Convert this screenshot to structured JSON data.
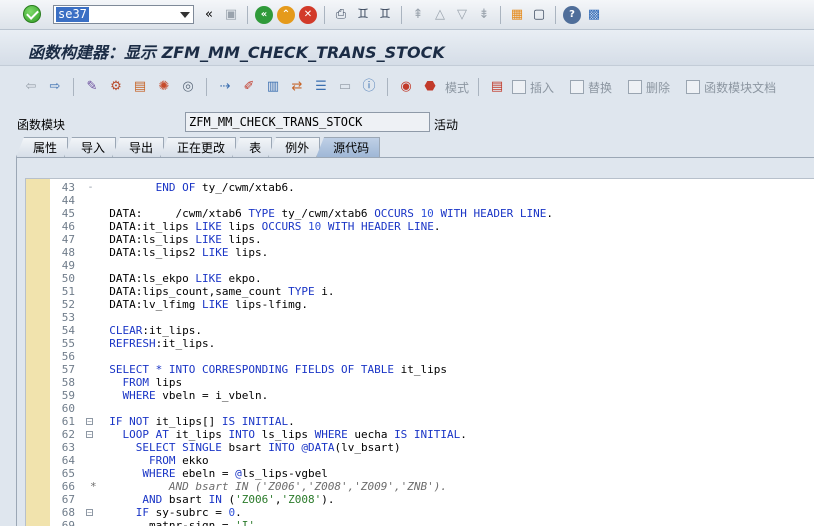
{
  "command": {
    "value": "se37"
  },
  "title": "函数构建器：显示 ZFM_MM_CHECK_TRANS_STOCK",
  "app_toolbar": {
    "buttons": [
      {
        "label": "模式"
      },
      {
        "label": "插入"
      },
      {
        "label": "替换"
      },
      {
        "label": "删除"
      },
      {
        "label": "函数模块文档"
      }
    ]
  },
  "function_module": {
    "label": "函数模块",
    "value": "ZFM_MM_CHECK_TRANS_STOCK",
    "status": "活动"
  },
  "tabs": [
    {
      "label": "属性",
      "active": false
    },
    {
      "label": "导入",
      "active": false
    },
    {
      "label": "导出",
      "active": false
    },
    {
      "label": "正在更改",
      "active": false
    },
    {
      "label": "表",
      "active": false
    },
    {
      "label": "例外",
      "active": false
    },
    {
      "label": "源代码",
      "active": true
    }
  ],
  "colors": {
    "keyword": "#1a35c6",
    "number": "#2d4fd8",
    "gutter": "#f1e3ad",
    "title": "#1b2c45"
  },
  "code": [
    {
      "n": "43",
      "fold": "dash",
      "t": [
        [
          "         ",
          ""
        ],
        [
          "END OF",
          "kw"
        ],
        [
          " ty_/cwm/xtab6.",
          ""
        ]
      ]
    },
    {
      "n": "44",
      "t": []
    },
    {
      "n": "45",
      "t": [
        [
          "  ",
          ""
        ],
        [
          "DATA",
          ""
        ],
        [
          ":     /cwm/xtab6 ",
          ""
        ],
        [
          "TYPE",
          "kw"
        ],
        [
          " ty_/cwm/xtab6 ",
          ""
        ],
        [
          "OCCURS",
          "kw"
        ],
        [
          " ",
          ""
        ],
        [
          "10",
          "num"
        ],
        [
          " ",
          ""
        ],
        [
          "WITH HEADER LINE",
          "kw"
        ],
        [
          ".",
          ""
        ]
      ]
    },
    {
      "n": "46",
      "t": [
        [
          "  ",
          ""
        ],
        [
          "DATA",
          ""
        ],
        [
          ":it_lips ",
          ""
        ],
        [
          "LIKE",
          "kw"
        ],
        [
          " lips ",
          ""
        ],
        [
          "OCCURS",
          "kw"
        ],
        [
          " ",
          ""
        ],
        [
          "10",
          "num"
        ],
        [
          " ",
          ""
        ],
        [
          "WITH HEADER LINE",
          "kw"
        ],
        [
          ".",
          ""
        ]
      ]
    },
    {
      "n": "47",
      "t": [
        [
          "  ",
          ""
        ],
        [
          "DATA",
          ""
        ],
        [
          ":ls_lips ",
          ""
        ],
        [
          "LIKE",
          "kw"
        ],
        [
          " lips.",
          ""
        ]
      ]
    },
    {
      "n": "48",
      "t": [
        [
          "  ",
          ""
        ],
        [
          "DATA",
          ""
        ],
        [
          ":ls_lips2 ",
          ""
        ],
        [
          "LIKE",
          "kw"
        ],
        [
          " lips.",
          ""
        ]
      ]
    },
    {
      "n": "49",
      "t": []
    },
    {
      "n": "50",
      "t": [
        [
          "  ",
          ""
        ],
        [
          "DATA",
          ""
        ],
        [
          ":ls_ekpo ",
          ""
        ],
        [
          "LIKE",
          "kw"
        ],
        [
          " ekpo.",
          ""
        ]
      ]
    },
    {
      "n": "51",
      "t": [
        [
          "  ",
          ""
        ],
        [
          "DATA",
          ""
        ],
        [
          ":lips_count,same_count ",
          ""
        ],
        [
          "TYPE",
          "kw"
        ],
        [
          " i.",
          ""
        ]
      ]
    },
    {
      "n": "52",
      "t": [
        [
          "  ",
          ""
        ],
        [
          "DATA",
          ""
        ],
        [
          ":lv_lfimg ",
          ""
        ],
        [
          "LIKE",
          "kw"
        ],
        [
          " lips-lfimg.",
          ""
        ]
      ]
    },
    {
      "n": "53",
      "t": []
    },
    {
      "n": "54",
      "t": [
        [
          "  ",
          ""
        ],
        [
          "CLEAR",
          "kw"
        ],
        [
          ":it_lips.",
          ""
        ]
      ]
    },
    {
      "n": "55",
      "t": [
        [
          "  ",
          ""
        ],
        [
          "REFRESH",
          "kw"
        ],
        [
          ":it_lips.",
          ""
        ]
      ]
    },
    {
      "n": "56",
      "t": []
    },
    {
      "n": "57",
      "t": [
        [
          "  ",
          ""
        ],
        [
          "SELECT",
          "kw"
        ],
        [
          " ",
          ""
        ],
        [
          "*",
          "kw"
        ],
        [
          " ",
          ""
        ],
        [
          "INTO CORRESPONDING FIELDS OF TABLE",
          "kw"
        ],
        [
          " it_lips",
          ""
        ]
      ]
    },
    {
      "n": "58",
      "t": [
        [
          "    ",
          ""
        ],
        [
          "FROM",
          "kw"
        ],
        [
          " lips",
          ""
        ]
      ]
    },
    {
      "n": "59",
      "t": [
        [
          "    ",
          ""
        ],
        [
          "WHERE",
          "kw"
        ],
        [
          " vbeln = i_vbeln.",
          ""
        ]
      ]
    },
    {
      "n": "60",
      "t": []
    },
    {
      "n": "61",
      "fold": "box",
      "t": [
        [
          "  ",
          ""
        ],
        [
          "IF NOT",
          "kw"
        ],
        [
          " it_lips[] ",
          ""
        ],
        [
          "IS INITIAL",
          "kw"
        ],
        [
          ".",
          ""
        ]
      ]
    },
    {
      "n": "62",
      "fold": "box",
      "t": [
        [
          "    ",
          ""
        ],
        [
          "LOOP AT",
          "kw"
        ],
        [
          " it_lips ",
          ""
        ],
        [
          "INTO",
          "kw"
        ],
        [
          " ls_lips ",
          ""
        ],
        [
          "WHERE",
          "kw"
        ],
        [
          " uecha ",
          ""
        ],
        [
          "IS INITIAL",
          "kw"
        ],
        [
          ".",
          ""
        ]
      ]
    },
    {
      "n": "63",
      "t": [
        [
          "      ",
          ""
        ],
        [
          "SELECT SINGLE",
          "kw"
        ],
        [
          " bsart ",
          ""
        ],
        [
          "INTO",
          "kw"
        ],
        [
          " ",
          ""
        ],
        [
          "@DATA",
          "kw"
        ],
        [
          "(lv_bsart)",
          ""
        ]
      ]
    },
    {
      "n": "64",
      "t": [
        [
          "        ",
          ""
        ],
        [
          "FROM",
          "kw"
        ],
        [
          " ekko",
          ""
        ]
      ]
    },
    {
      "n": "65",
      "t": [
        [
          "       ",
          ""
        ],
        [
          "WHERE",
          "kw"
        ],
        [
          " ebeln = ",
          ""
        ],
        [
          "@",
          "kw"
        ],
        [
          "ls_lips-vgbel",
          ""
        ]
      ]
    },
    {
      "n": "66",
      "star": true,
      "t": [
        [
          "           ",
          ""
        ],
        [
          "AND bsart IN ('Z006','Z008','Z009','ZNB').",
          "cmt"
        ]
      ]
    },
    {
      "n": "67",
      "t": [
        [
          "       ",
          ""
        ],
        [
          "AND",
          "kw"
        ],
        [
          " bsart ",
          ""
        ],
        [
          "IN",
          "kw"
        ],
        [
          " (",
          ""
        ],
        [
          "'Z006'",
          "str"
        ],
        [
          ",",
          ""
        ],
        [
          "'Z008'",
          "str"
        ],
        [
          ").",
          ""
        ]
      ]
    },
    {
      "n": "68",
      "fold": "box",
      "t": [
        [
          "      ",
          ""
        ],
        [
          "IF",
          "kw"
        ],
        [
          " sy-subrc = ",
          ""
        ],
        [
          "0",
          "num"
        ],
        [
          ".",
          ""
        ]
      ]
    },
    {
      "n": "69",
      "t": [
        [
          "        matnr-sign = ",
          ""
        ],
        [
          "'I'",
          "str"
        ],
        [
          ".",
          ""
        ]
      ]
    }
  ]
}
